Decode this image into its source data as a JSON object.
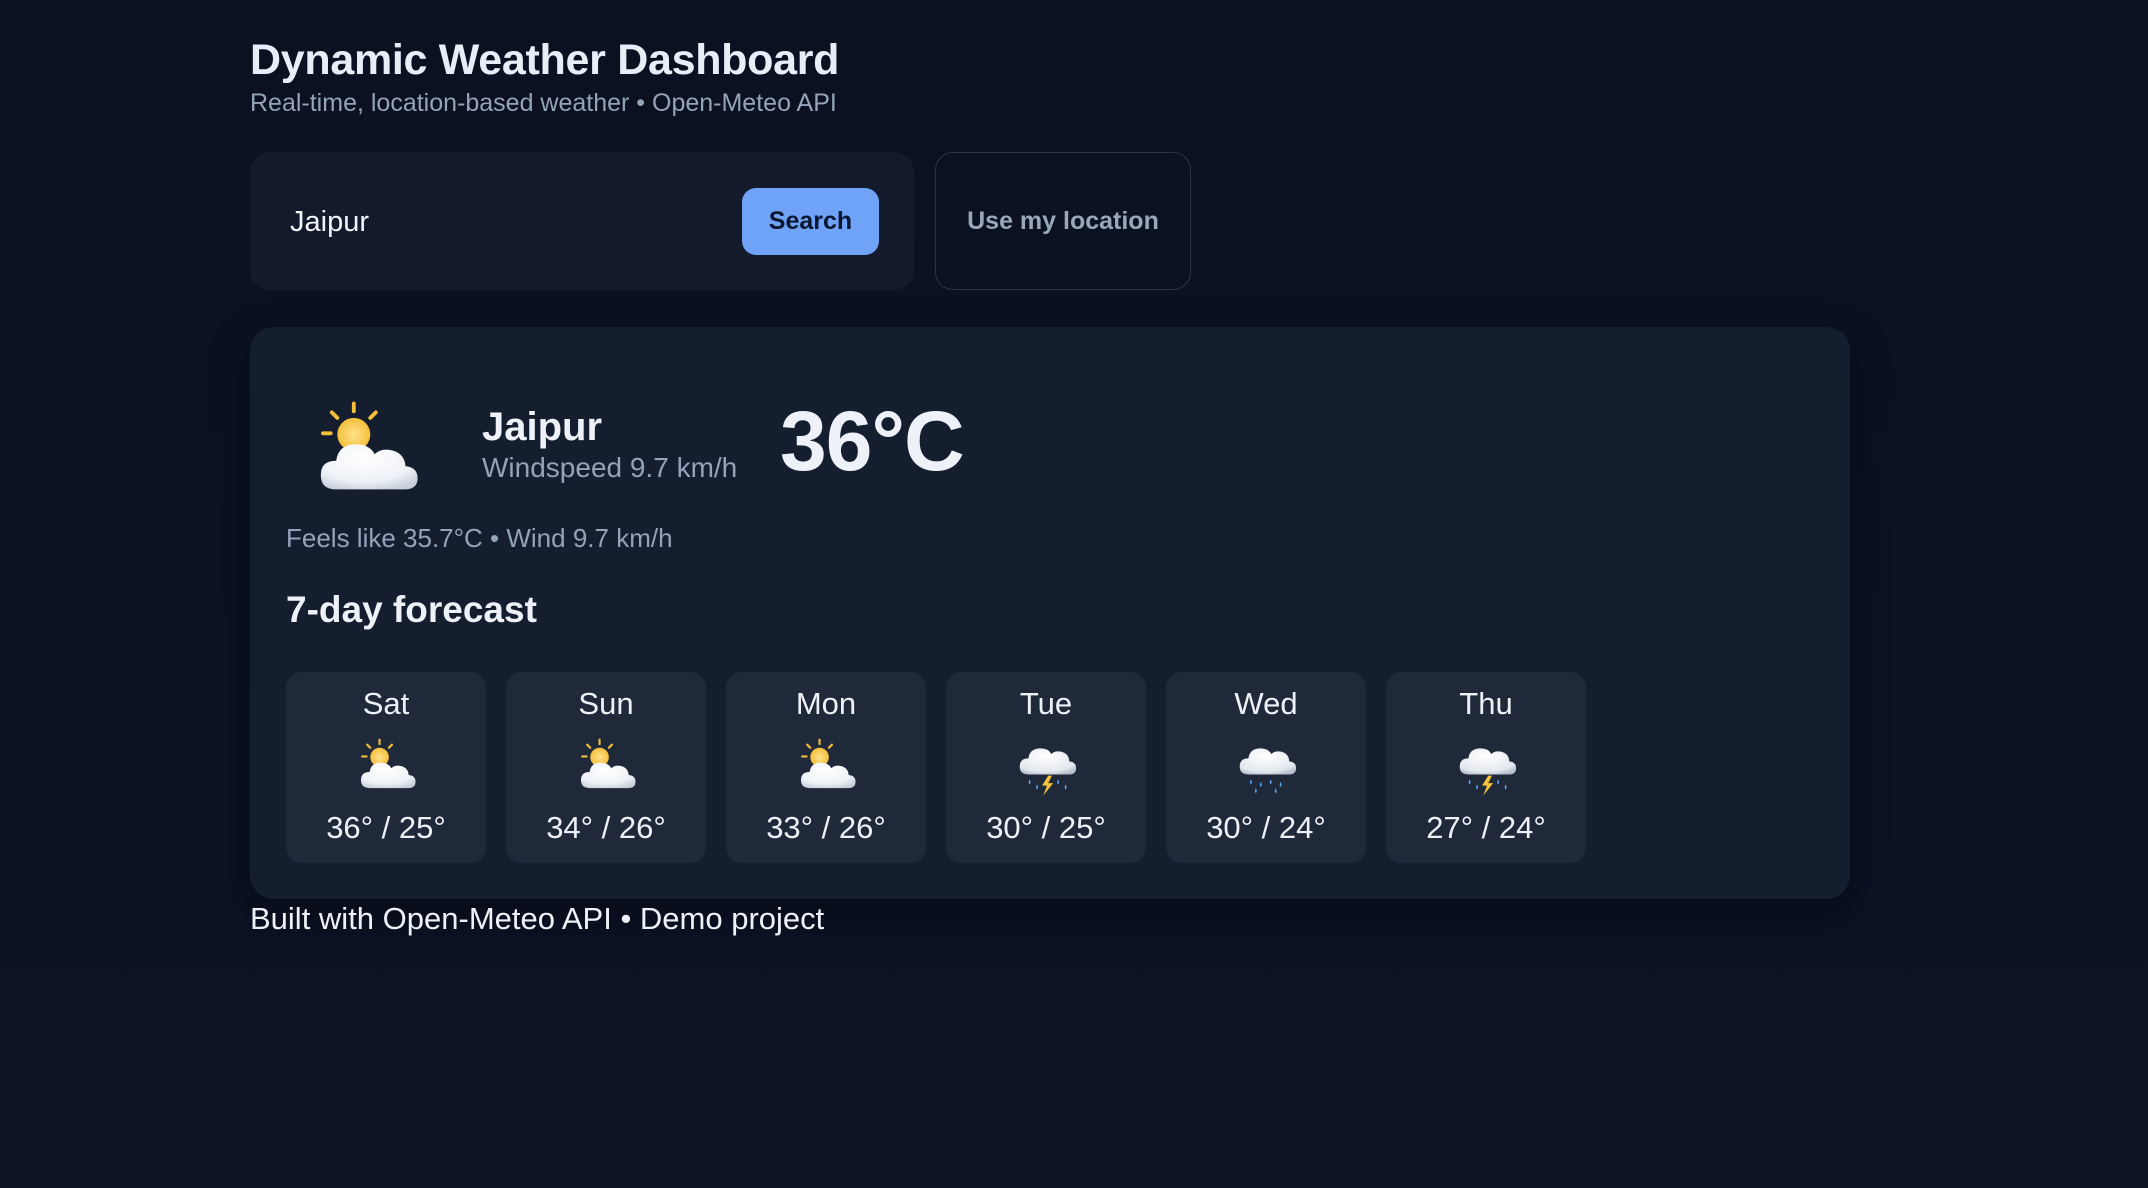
{
  "header": {
    "title": "Dynamic Weather Dashboard",
    "subtitle": "Real-time, location-based weather • Open-Meteo API"
  },
  "search": {
    "value": "Jaipur",
    "button_label": "Search",
    "location_button_label": "Use my location"
  },
  "current": {
    "icon": "sun-behind-cloud-icon",
    "city": "Jaipur",
    "windspeed": "Windspeed 9.7 km/h",
    "temperature": "36°C",
    "details": "Feels like 35.7°C • Wind 9.7 km/h"
  },
  "forecast": {
    "heading": "7-day forecast",
    "days": [
      {
        "day": "Sat",
        "icon": "sun-behind-cloud-icon",
        "temps": "36° / 25°"
      },
      {
        "day": "Sun",
        "icon": "sun-behind-cloud-icon",
        "temps": "34° / 26°"
      },
      {
        "day": "Mon",
        "icon": "sun-behind-cloud-icon",
        "temps": "33° / 26°"
      },
      {
        "day": "Tue",
        "icon": "thunder-rain-cloud-icon",
        "temps": "30° / 25°"
      },
      {
        "day": "Wed",
        "icon": "rain-cloud-icon",
        "temps": "30° / 24°"
      },
      {
        "day": "Thu",
        "icon": "thunder-rain-cloud-icon",
        "temps": "27° / 24°"
      }
    ]
  },
  "footer": {
    "text": "Built with Open-Meteo API • Demo project"
  },
  "colors": {
    "background": "#0b1120",
    "card": "#151e2f",
    "day_card": "#1f293a",
    "accent": "#6ea3f7",
    "muted_text": "#94a3b8"
  }
}
